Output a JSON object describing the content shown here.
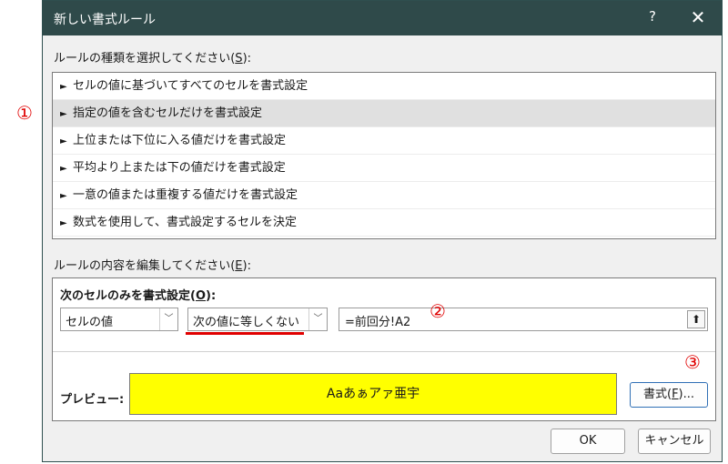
{
  "dialog": {
    "title": "新しい書式ルール",
    "help_icon": "?",
    "close_icon": "✕"
  },
  "rule_type": {
    "label_pre": "ルールの種類を選択してください(",
    "label_key": "S",
    "label_post": "):",
    "selected_index": 1,
    "items": [
      {
        "label": "セルの値に基づいてすべてのセルを書式設定"
      },
      {
        "label": "指定の値を含むセルだけを書式設定"
      },
      {
        "label": "上位または下位に入る値だけを書式設定"
      },
      {
        "label": "平均より上または下の値だけを書式設定"
      },
      {
        "label": "一意の値または重複する値だけを書式設定"
      },
      {
        "label": "数式を使用して、書式設定するセルを決定"
      }
    ],
    "arrow_glyph": "►"
  },
  "rule_edit": {
    "label_pre": "ルールの内容を編集してください(",
    "label_key": "E",
    "label_post": "):",
    "subhead_pre": "次のセルのみを書式設定(",
    "subhead_key": "O",
    "subhead_post": "):",
    "condition_type": "セルの値",
    "operator": "次の値に等しくない",
    "value": "=前回分!A2",
    "collapse_icon": "⬆",
    "preview_label": "プレビュー:",
    "preview_text": "Aaあぁアァ亜宇",
    "preview_color": "#ffff00",
    "format_button_pre": "書式(",
    "format_button_key": "F",
    "format_button_post": ")..."
  },
  "buttons": {
    "ok": "OK",
    "cancel": "キャンセル"
  },
  "annotations": {
    "one": "①",
    "two": "②",
    "three": "③",
    "color": "#e00000"
  }
}
